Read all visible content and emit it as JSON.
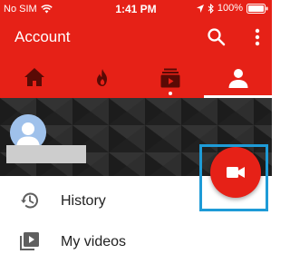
{
  "status_bar": {
    "carrier": "No SIM",
    "time": "1:41 PM",
    "battery": "100%",
    "icons": [
      "wifi-icon",
      "location-arrow-icon",
      "bluetooth-icon",
      "battery-icon"
    ]
  },
  "app_bar": {
    "title": "Account",
    "actions": [
      "search-icon",
      "more-vert-icon"
    ]
  },
  "tabs": [
    {
      "id": "home",
      "icon": "home-icon",
      "selected": false
    },
    {
      "id": "trending",
      "icon": "flame-icon",
      "selected": false
    },
    {
      "id": "subscriptions",
      "icon": "subscriptions-icon",
      "selected": false,
      "has_new_dot": true
    },
    {
      "id": "account",
      "icon": "person-icon",
      "selected": true
    }
  ],
  "profile": {
    "avatar_icon": "default-avatar-icon"
  },
  "fab": {
    "icon": "video-camera-icon",
    "highlighted": true
  },
  "menu": [
    {
      "label": "History",
      "icon": "history-icon"
    },
    {
      "label": "My videos",
      "icon": "my-videos-icon"
    }
  ],
  "colors": {
    "brand_red": "#e62117",
    "highlight_blue": "#1e9bd7",
    "banner_dark": "#232323"
  }
}
